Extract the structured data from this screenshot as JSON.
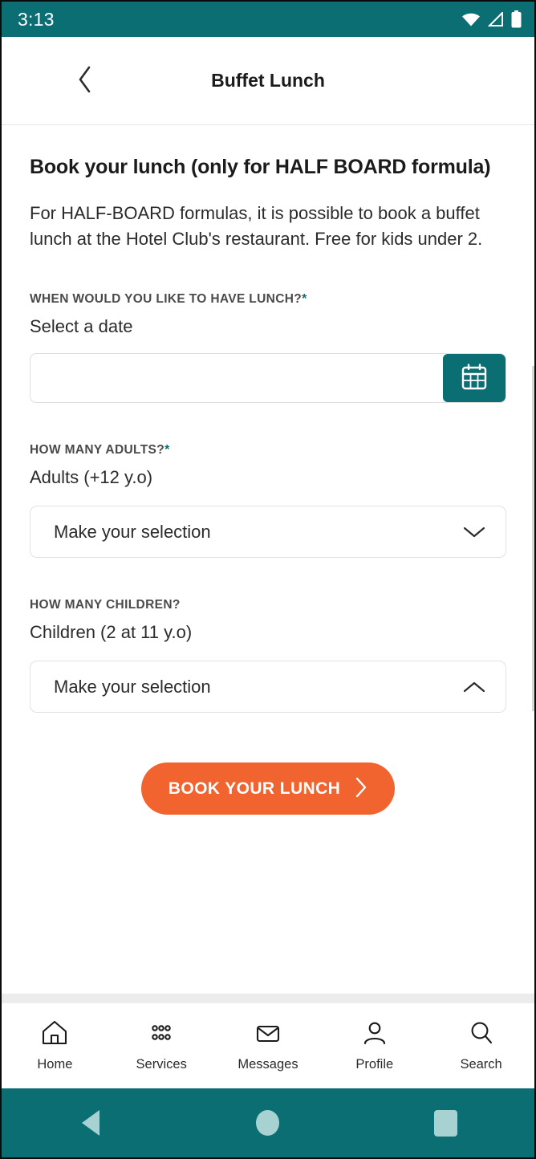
{
  "theme": {
    "teal": "#0a6e72",
    "orange": "#f2642f",
    "text_primary": "#1b1b1b",
    "text_secondary": "#4a4a4a",
    "android_nav_icon": "#a8d2d2"
  },
  "status_bar": {
    "time": "3:13",
    "icons": [
      "wifi-icon",
      "cell-signal-icon",
      "battery-icon"
    ]
  },
  "app_bar": {
    "back_icon": "chevron-left-icon",
    "title": "Buffet Lunch"
  },
  "main": {
    "heading": "Book your lunch (only for HALF BOARD formula)",
    "description": "For HALF-BOARD formulas, it is possible to book a buffet lunch at the Hotel Club's restaurant. Free for kids under 2.",
    "date_field": {
      "label": "WHEN WOULD YOU LIKE TO HAVE LUNCH?",
      "required": true,
      "required_marker": "*",
      "sublabel": "Select a date",
      "value": "",
      "placeholder": "",
      "button_icon": "calendar-icon"
    },
    "adults_field": {
      "label": "HOW MANY ADULTS?",
      "required": true,
      "required_marker": "*",
      "sublabel": "Adults (+12 y.o)",
      "value": "Make your selection",
      "chevron_icon": "chevron-down-icon"
    },
    "children_field": {
      "label": "HOW MANY CHILDREN?",
      "required": false,
      "required_marker": "",
      "sublabel": "Children (2 at 11 y.o)",
      "value": "Make your selection",
      "chevron_icon": "chevron-up-icon"
    },
    "cta": {
      "label": "BOOK YOUR LUNCH",
      "icon": "chevron-right-icon"
    }
  },
  "bottom_nav": {
    "items": [
      {
        "label": "Home",
        "icon": "home-icon"
      },
      {
        "label": "Services",
        "icon": "grid-dots-icon"
      },
      {
        "label": "Messages",
        "icon": "envelope-icon"
      },
      {
        "label": "Profile",
        "icon": "person-icon"
      },
      {
        "label": "Search",
        "icon": "search-icon"
      }
    ]
  },
  "android_nav": {
    "buttons": [
      {
        "name": "back",
        "icon": "triangle-back-icon"
      },
      {
        "name": "home",
        "icon": "circle-home-icon"
      },
      {
        "name": "recents",
        "icon": "square-recents-icon"
      }
    ]
  }
}
